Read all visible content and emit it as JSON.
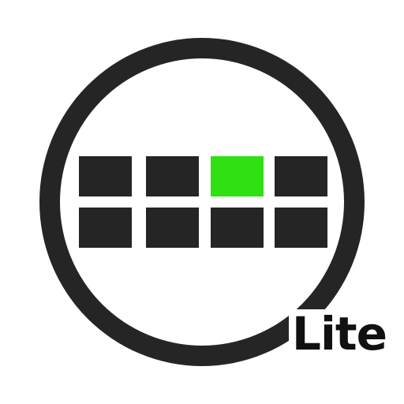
{
  "app_icon": {
    "badge_text": "Lite",
    "colors": {
      "background": "#ffffff",
      "ring": "#252525",
      "cell_off": "#252525",
      "cell_on": "#2fe012",
      "badge_text": "#111111"
    },
    "grid": {
      "rows": 2,
      "columns": 4,
      "cells": [
        [
          "off",
          "off",
          "on",
          "off"
        ],
        [
          "off",
          "off",
          "off",
          "off"
        ]
      ]
    }
  }
}
